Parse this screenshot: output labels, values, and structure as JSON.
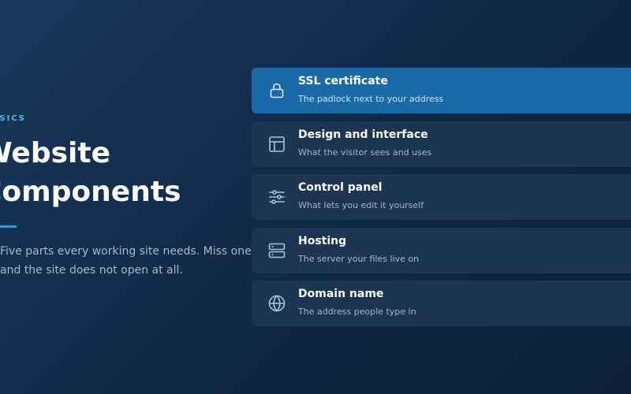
{
  "hero": {
    "eyebrow": "BASICS",
    "title_line1": "Website",
    "title_line2": "Components",
    "description_line1": "Five parts every working site needs. Miss one",
    "description_line2": "and the site does not open at all."
  },
  "components": [
    {
      "title": "SSL certificate",
      "subtitle": "The padlock next to your address",
      "icon": "padlock-icon",
      "selected": true
    },
    {
      "title": "Design and interface",
      "subtitle": "What the visitor sees and uses",
      "icon": "layout-icon",
      "selected": false
    },
    {
      "title": "Control panel",
      "subtitle": "What lets you edit it yourself",
      "icon": "sliders-icon",
      "selected": false
    },
    {
      "title": "Hosting",
      "subtitle": "The server your files live on",
      "icon": "server-icon",
      "selected": false
    },
    {
      "title": "Domain name",
      "subtitle": "The address people type in",
      "icon": "globe-icon",
      "selected": false
    }
  ],
  "colors": {
    "accent": "#4fb6ec",
    "active_card": "#1a6aa8",
    "card": "#1d3452",
    "icon_stroke": "#a9c4e0"
  }
}
